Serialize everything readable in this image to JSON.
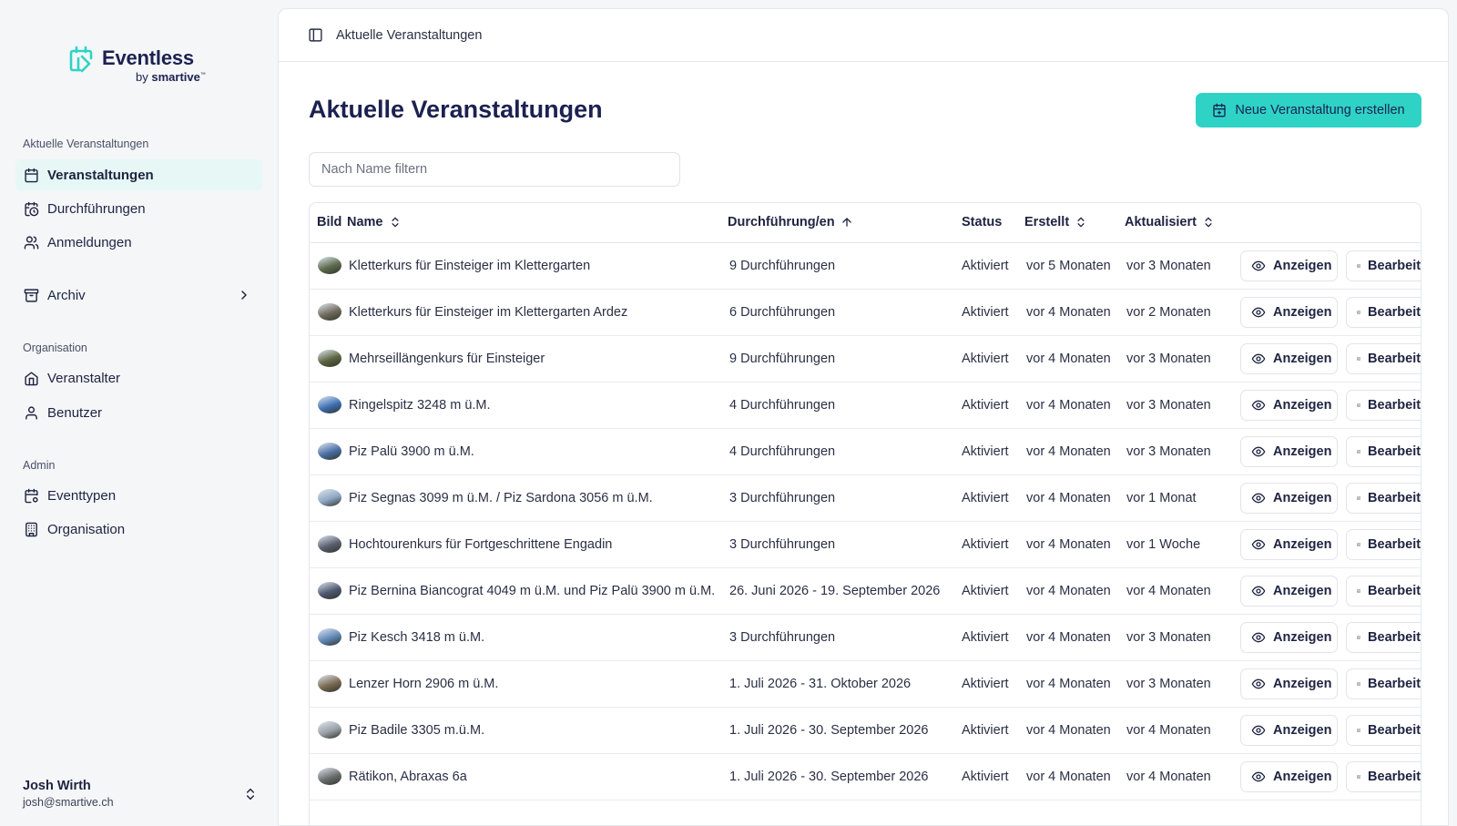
{
  "brand": {
    "name": "Eventless",
    "by": "by",
    "company": "smartive",
    "tm": "™"
  },
  "sidebar": {
    "groups": [
      {
        "title": "Aktuelle Veranstaltungen",
        "items": [
          {
            "label": "Veranstaltungen",
            "icon": "calendar-icon",
            "active": true
          },
          {
            "label": "Durchführungen",
            "icon": "calendar-clock-icon"
          },
          {
            "label": "Anmeldungen",
            "icon": "users-icon"
          },
          {
            "label": "Archiv",
            "icon": "archive-icon"
          }
        ]
      },
      {
        "title": "Organisation",
        "items": [
          {
            "label": "Veranstalter",
            "icon": "home-icon"
          },
          {
            "label": "Benutzer",
            "icon": "user-icon"
          }
        ]
      },
      {
        "title": "Admin",
        "items": [
          {
            "label": "Eventtypen",
            "icon": "calendar-cog-icon"
          },
          {
            "label": "Organisation",
            "icon": "building-icon"
          }
        ]
      }
    ],
    "user": {
      "name": "Josh Wirth",
      "email": "josh@smartive.ch"
    }
  },
  "topbar": {
    "breadcrumb": "Aktuelle Veranstaltungen"
  },
  "main": {
    "title": "Aktuelle Veranstaltungen",
    "new_button": "Neue Veranstaltung erstellen",
    "filter_placeholder": "Nach Name filtern",
    "accent": "#2ed3c6"
  },
  "table": {
    "columns": [
      "Bild",
      "Name",
      "Durchführung/en",
      "Status",
      "Erstellt",
      "Aktualisiert"
    ],
    "view_label": "Anzeigen",
    "edit_label": "Bearbeiten",
    "rows": [
      {
        "name": "Kletterkurs für Einsteiger im Klettergarten",
        "runs": "9 Durchführungen",
        "status": "Aktiviert",
        "created": "vor 5 Monaten",
        "updated": "vor 3 Monaten",
        "thumb": "#5d6a4e"
      },
      {
        "name": "Kletterkurs für Einsteiger im Klettergarten Ardez",
        "runs": "6 Durchführungen",
        "status": "Aktiviert",
        "created": "vor 4 Monaten",
        "updated": "vor 2 Monaten",
        "thumb": "#6f6a5c"
      },
      {
        "name": "Mehrseillängenkurs für Einsteiger",
        "runs": "9 Durchführungen",
        "status": "Aktiviert",
        "created": "vor 4 Monaten",
        "updated": "vor 3 Monaten",
        "thumb": "#5b6440"
      },
      {
        "name": "Ringelspitz 3248 m ü.M.",
        "runs": "4 Durchführungen",
        "status": "Aktiviert",
        "created": "vor 4 Monaten",
        "updated": "vor 3 Monaten",
        "thumb": "#3d6fb3"
      },
      {
        "name": "Piz Palü 3900 m ü.M.",
        "runs": "4 Durchführungen",
        "status": "Aktiviert",
        "created": "vor 4 Monaten",
        "updated": "vor 3 Monaten",
        "thumb": "#4a6ea5"
      },
      {
        "name": "Piz Segnas 3099 m ü.M. / Piz Sardona 3056 m ü.M.",
        "runs": "3 Durchführungen",
        "status": "Aktiviert",
        "created": "vor 4 Monaten",
        "updated": "vor 1 Monat",
        "thumb": "#8fa6c4"
      },
      {
        "name": "Hochtourenkurs für Fortgeschrittene Engadin",
        "runs": "3 Durchführungen",
        "status": "Aktiviert",
        "created": "vor 4 Monaten",
        "updated": "vor 1 Woche",
        "thumb": "#5a5f6e"
      },
      {
        "name": "Piz Bernina Biancograt 4049 m ü.M. und Piz Palü 3900 m ü.M.",
        "runs": "26. Juni 2026 - 19. September 2026",
        "status": "Aktiviert",
        "created": "vor 4 Monaten",
        "updated": "vor 4 Monaten",
        "thumb": "#4c5870"
      },
      {
        "name": "Piz Kesch 3418 m ü.M.",
        "runs": "3 Durchführungen",
        "status": "Aktiviert",
        "created": "vor 4 Monaten",
        "updated": "vor 3 Monaten",
        "thumb": "#5f86b6"
      },
      {
        "name": "Lenzer Horn 2906 m ü.M.",
        "runs": "1. Juli 2026 - 31. Oktober 2026",
        "status": "Aktiviert",
        "created": "vor 4 Monaten",
        "updated": "vor 3 Monaten",
        "thumb": "#7a6a52"
      },
      {
        "name": "Piz Badile 3305 m.ü.M.",
        "runs": "1. Juli 2026 - 30. September 2026",
        "status": "Aktiviert",
        "created": "vor 4 Monaten",
        "updated": "vor 4 Monaten",
        "thumb": "#9aa0a8"
      },
      {
        "name": "Rätikon, Abraxas 6a",
        "runs": "1. Juli 2026 - 30. September 2026",
        "status": "Aktiviert",
        "created": "vor 4 Monaten",
        "updated": "vor 4 Monaten",
        "thumb": "#6b6e70"
      }
    ]
  }
}
